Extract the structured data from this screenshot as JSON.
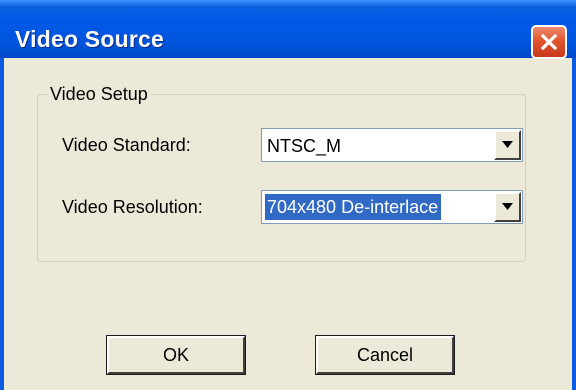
{
  "window": {
    "title": "Video Source",
    "close_icon": "close-icon"
  },
  "group": {
    "legend": "Video Setup"
  },
  "fields": {
    "standard": {
      "label": "Video Standard:",
      "value": "NTSC_M"
    },
    "resolution": {
      "label": "Video Resolution:",
      "value": "704x480 De-interlace"
    }
  },
  "buttons": {
    "ok": "OK",
    "cancel": "Cancel"
  },
  "colors": {
    "titlebar": "#0055dc",
    "selection": "#316ac5",
    "close": "#e2572f",
    "face": "#ece9d8"
  }
}
